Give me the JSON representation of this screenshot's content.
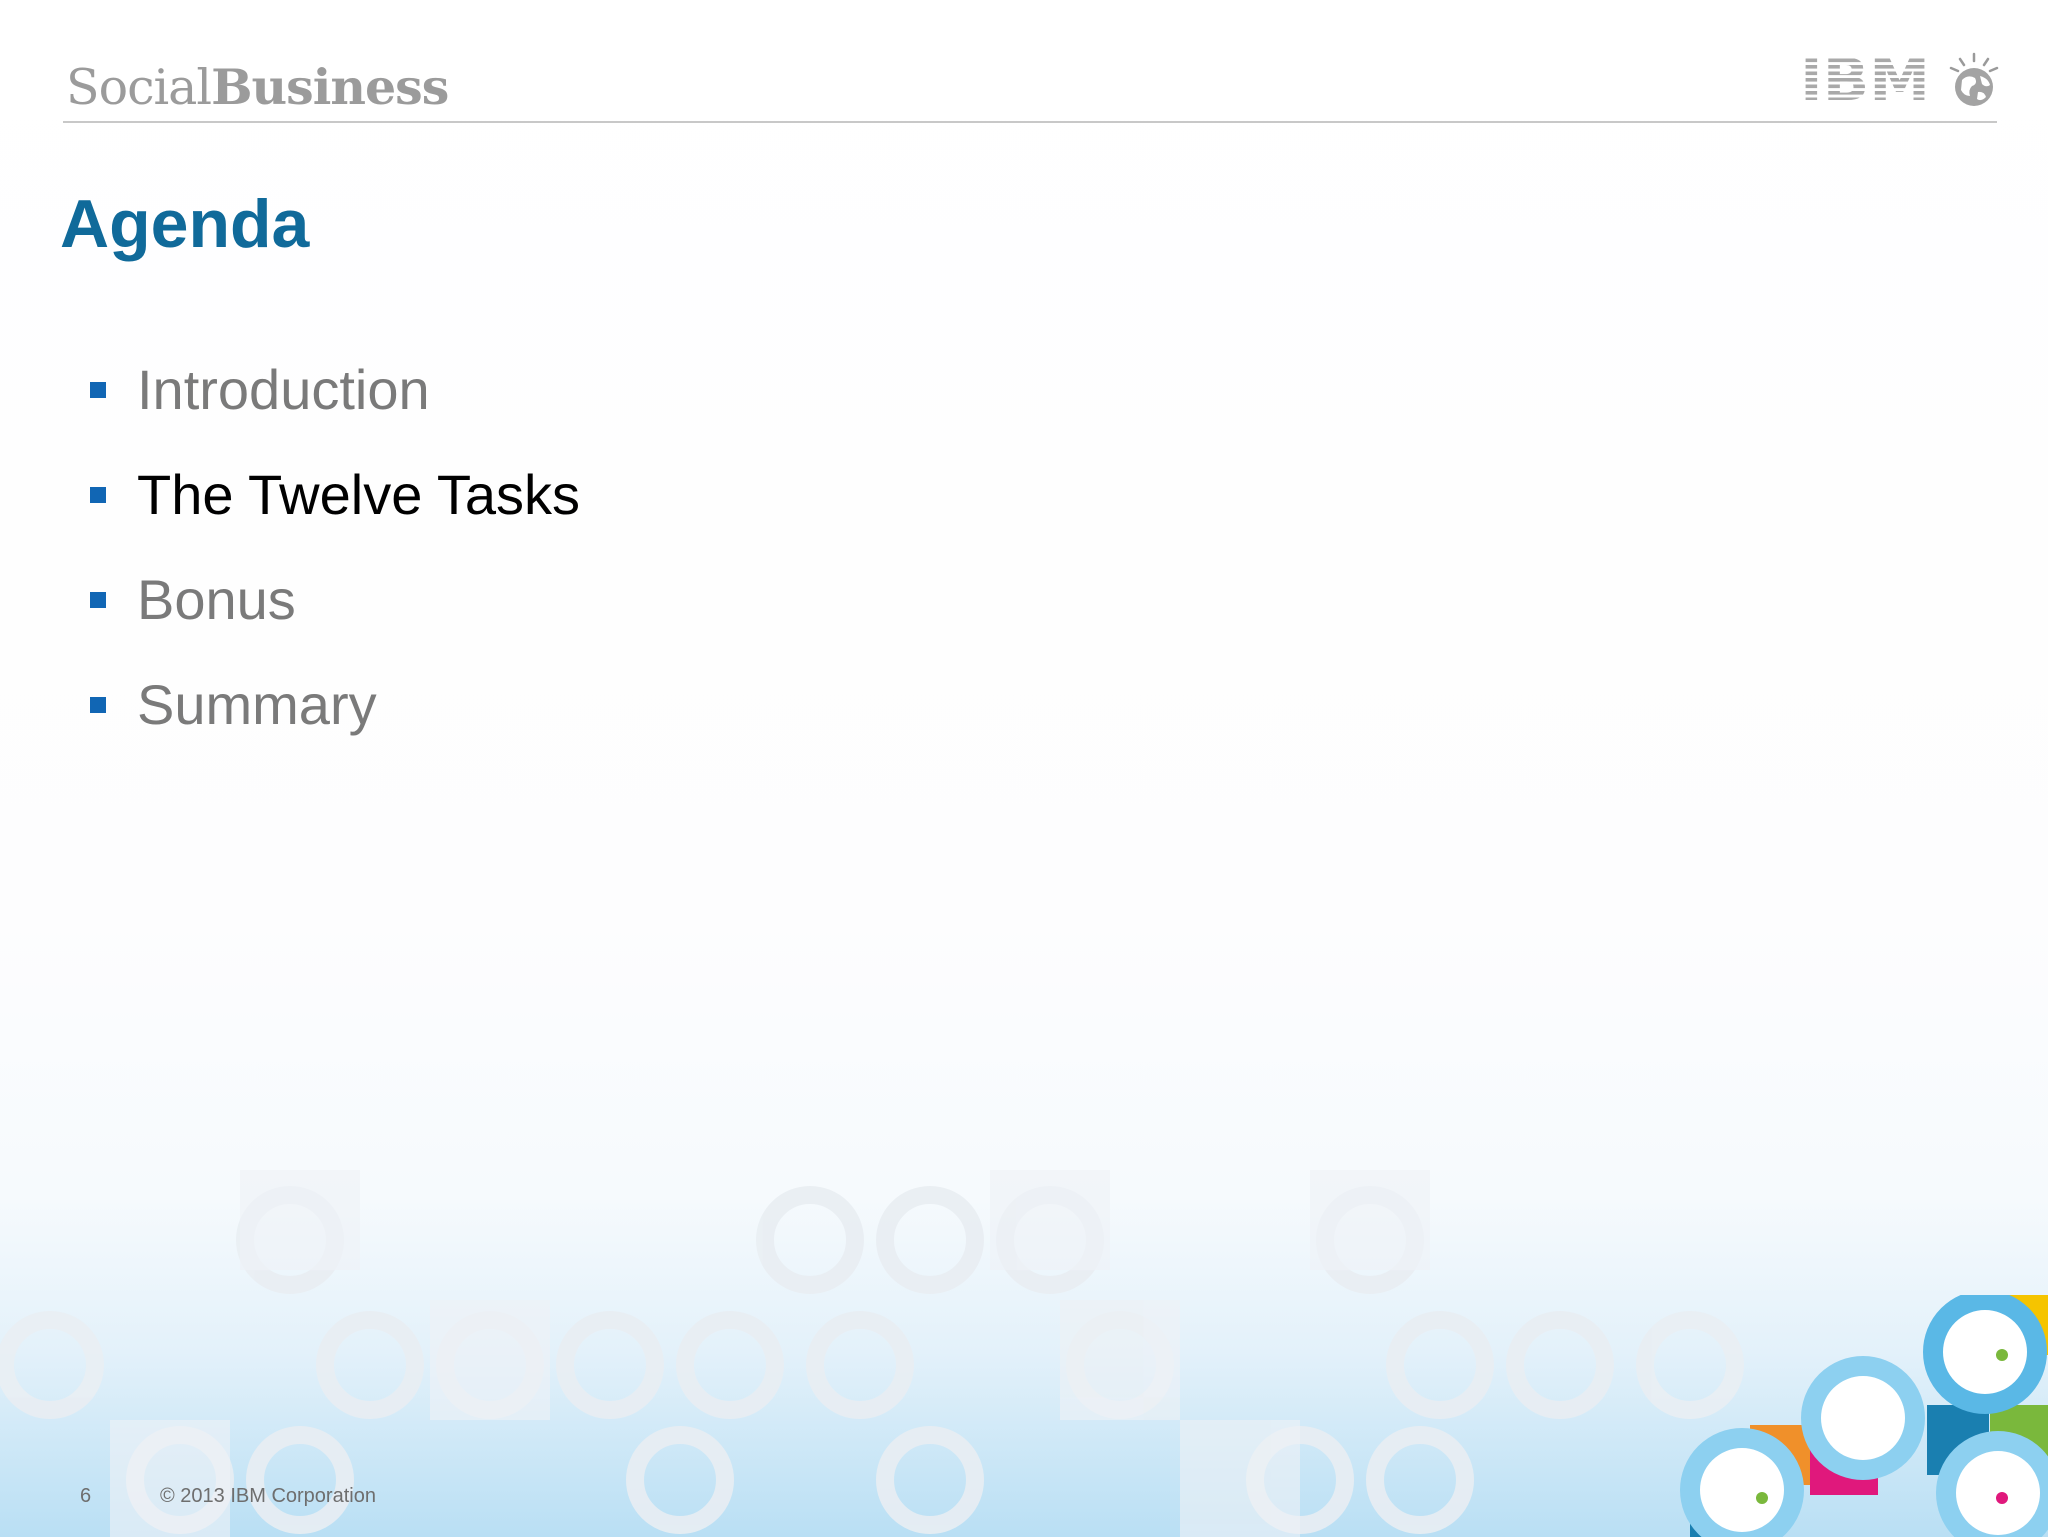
{
  "header": {
    "brand_light": "Social",
    "brand_bold": "Business",
    "logo_label": "IBM",
    "logo_icon": "ibm-smarter-planet-globe-icon"
  },
  "title": "Agenda",
  "bullets": [
    {
      "label": "Introduction",
      "active": false
    },
    {
      "label": "The Twelve Tasks",
      "active": true
    },
    {
      "label": "Bonus",
      "active": false
    },
    {
      "label": "Summary",
      "active": false
    }
  ],
  "footer": {
    "page_number": "6",
    "copyright": "© 2013 IBM Corporation"
  },
  "colors": {
    "title": "#106a9a",
    "bullet_marker": "#1166b4",
    "inactive_text": "#7a7a7a",
    "active_text": "#000000",
    "deco_blue": "#3aa8e0",
    "deco_light_blue": "#8dd0f0",
    "deco_orange": "#f0902a",
    "deco_magenta": "#e0187c",
    "deco_green": "#7ab83c",
    "deco_yellow": "#f5c400",
    "deco_dark_blue": "#1a7fb0"
  }
}
